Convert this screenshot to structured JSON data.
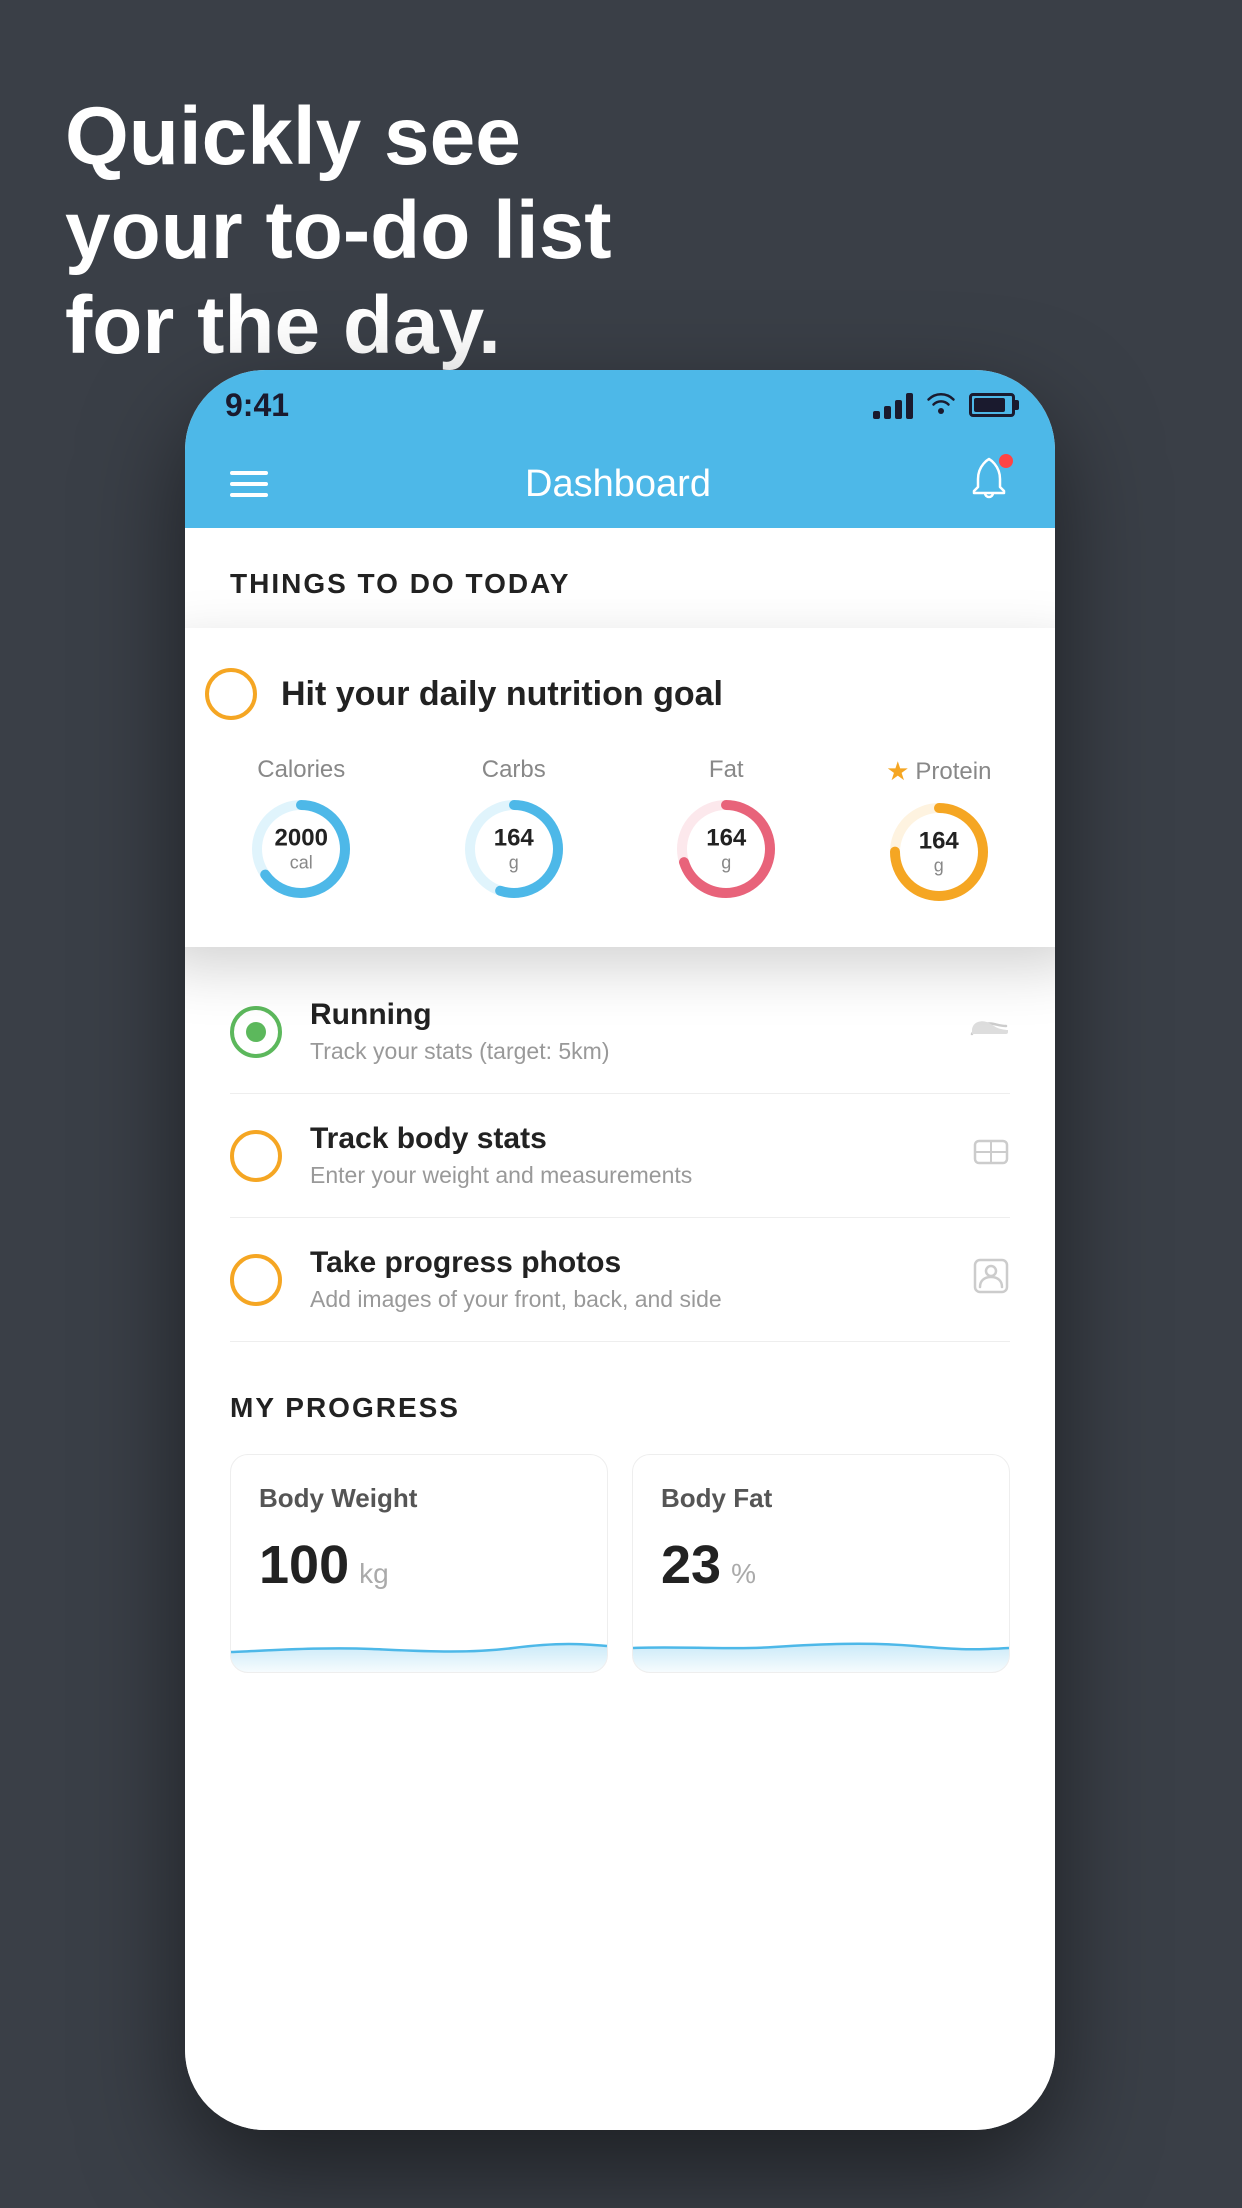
{
  "headline": {
    "line1": "Quickly see",
    "line2": "your to-do list",
    "line3": "for the day."
  },
  "status_bar": {
    "time": "9:41"
  },
  "nav": {
    "title": "Dashboard"
  },
  "things_header": "THINGS TO DO TODAY",
  "highlight_card": {
    "title": "Hit your daily nutrition goal",
    "items": [
      {
        "label": "Calories",
        "value": "2000",
        "unit": "cal",
        "color": "#4db8e8",
        "track_color": "#e0f4fc",
        "pct": 65,
        "star": false
      },
      {
        "label": "Carbs",
        "value": "164",
        "unit": "g",
        "color": "#4db8e8",
        "track_color": "#e0f4fc",
        "pct": 55,
        "star": false
      },
      {
        "label": "Fat",
        "value": "164",
        "unit": "g",
        "color": "#e8637a",
        "track_color": "#fce8ec",
        "pct": 70,
        "star": false
      },
      {
        "label": "Protein",
        "value": "164",
        "unit": "g",
        "color": "#f5a623",
        "track_color": "#fef3e0",
        "pct": 75,
        "star": true
      }
    ]
  },
  "todo_items": [
    {
      "title": "Running",
      "subtitle": "Track your stats (target: 5km)",
      "circle": "green",
      "icon": "shoe"
    },
    {
      "title": "Track body stats",
      "subtitle": "Enter your weight and measurements",
      "circle": "yellow",
      "icon": "scale"
    },
    {
      "title": "Take progress photos",
      "subtitle": "Add images of your front, back, and side",
      "circle": "yellow",
      "icon": "person"
    }
  ],
  "progress": {
    "header": "MY PROGRESS",
    "cards": [
      {
        "title": "Body Weight",
        "value": "100",
        "unit": "kg"
      },
      {
        "title": "Body Fat",
        "value": "23",
        "unit": "%"
      }
    ]
  }
}
